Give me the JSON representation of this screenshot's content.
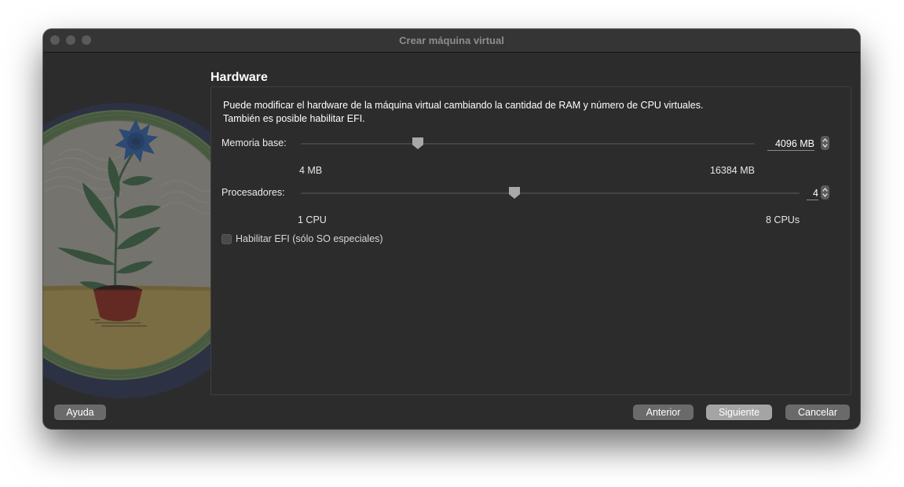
{
  "window": {
    "title": "Crear máquina virtual"
  },
  "page": {
    "heading": "Hardware",
    "description_line1": "Puede modificar el hardware de la máquina virtual cambiando la cantidad de RAM y número de CPU virtuales.",
    "description_line2": "También es posible habilitar EFI."
  },
  "memory": {
    "label": "Memoria base:",
    "value": "4096 MB",
    "value_mb": 4096,
    "min_label": "4 MB",
    "max_label": "16384 MB",
    "min": 4,
    "max": 16384
  },
  "processors": {
    "label": "Procesadores:",
    "value": "4",
    "value_count": 4,
    "min_label": "1 CPU",
    "max_label": "8 CPUs",
    "min": 1,
    "max": 8
  },
  "efi": {
    "label": "Habilitar EFI (sólo SO especiales)",
    "checked": false
  },
  "buttons": {
    "help": "Ayuda",
    "back": "Anterior",
    "next": "Siguiente",
    "cancel": "Cancelar"
  },
  "icons": {
    "close": "window-close-icon",
    "minimize": "window-minimize-icon",
    "zoom": "window-zoom-icon",
    "stepper": "stepper-arrows-icon"
  },
  "colors": {
    "window_bg": "#2c2c2c",
    "primary_button": "#a4a4a4",
    "secondary_button": "#6a6a6a"
  }
}
